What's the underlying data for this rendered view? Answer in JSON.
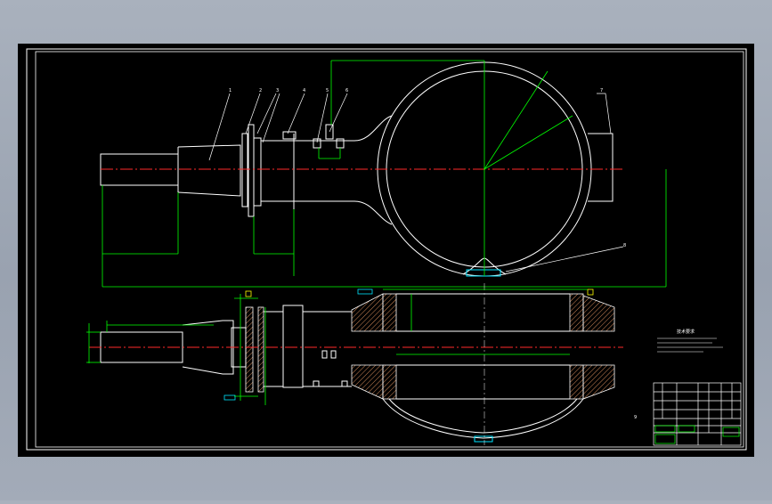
{
  "colors": {
    "background": "#9fa8b5",
    "sheet": "#000000",
    "outline": "#ffffff",
    "centerline": "#ff2a2a",
    "dimension": "#00ff00",
    "hatch": "#d28a5a",
    "cyan": "#00e5ff",
    "yellow": "#ffff00"
  },
  "balloons": [
    "1",
    "2",
    "3",
    "4",
    "5",
    "6",
    "7",
    "8",
    "9"
  ],
  "notes": {
    "heading": "技术要求",
    "lines": [
      "",
      "",
      ""
    ]
  },
  "title_block": {
    "rows": [
      [
        "",
        "",
        "",
        "",
        ""
      ],
      [
        "",
        "",
        "",
        "",
        ""
      ],
      [
        "",
        "",
        "",
        "",
        ""
      ],
      [
        "",
        "",
        "",
        "",
        ""
      ],
      [
        "",
        "",
        "",
        "",
        ""
      ]
    ]
  }
}
